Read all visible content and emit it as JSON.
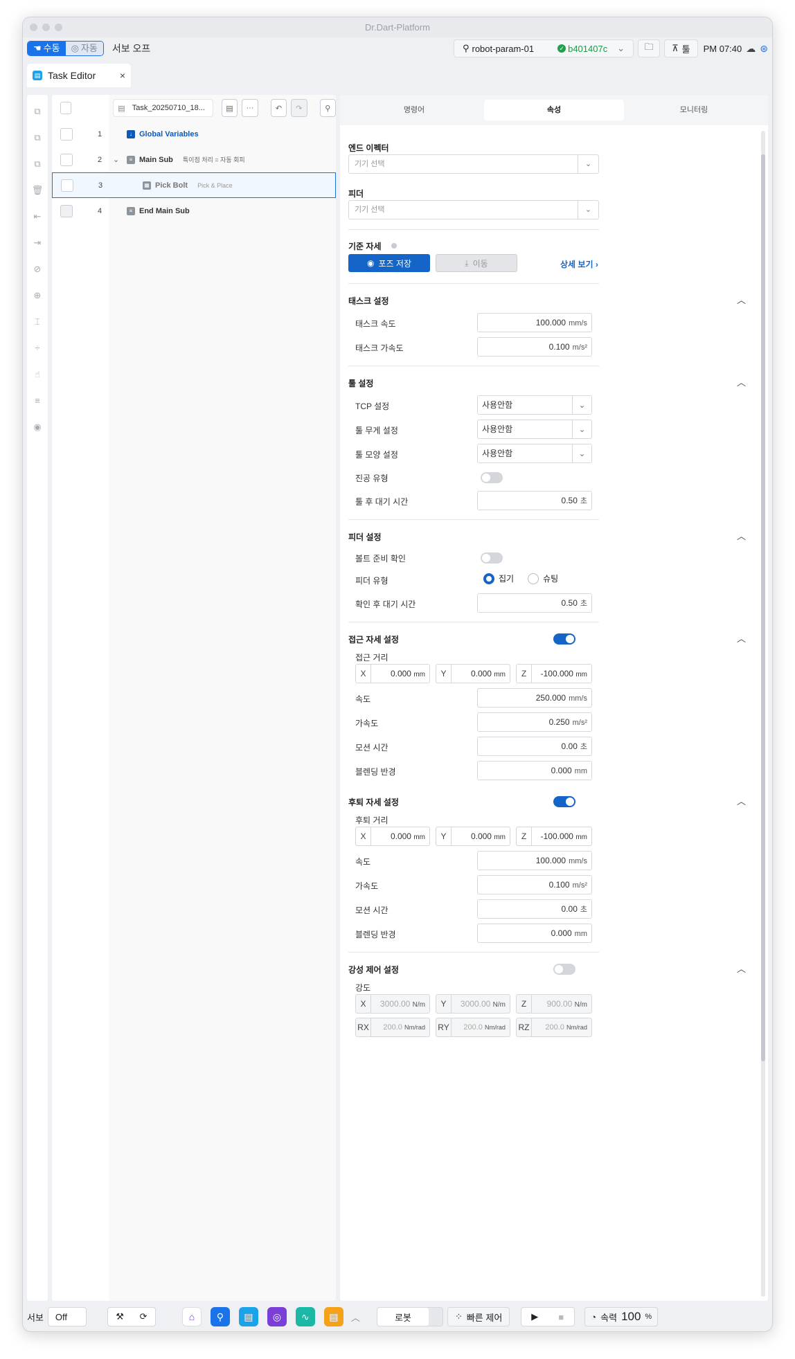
{
  "window": {
    "title": "Dr.Dart-Platform"
  },
  "toolbar": {
    "manual": "수동",
    "auto": "자동",
    "servo_off": "서보 오프",
    "robot_name": "robot-param-01",
    "version": "b401407c",
    "tool": "툴",
    "time": "PM 07:40"
  },
  "tab": {
    "label": "Task Editor",
    "close": "×"
  },
  "tree": {
    "file_name": "Task_20250710_18...",
    "more": "···",
    "rows": [
      {
        "num": "1",
        "label": "Global Variables",
        "sub": ""
      },
      {
        "num": "2",
        "label": "Main Sub",
        "sub": "특이점 처리 = 자동 회피"
      },
      {
        "num": "3",
        "label": "Pick Bolt",
        "sub": "Pick & Place"
      },
      {
        "num": "4",
        "label": "End Main Sub",
        "sub": ""
      }
    ]
  },
  "rtabs": [
    "명령어",
    "속성",
    "모니터링"
  ],
  "props": {
    "end_effector": {
      "title": "엔드 이펙터",
      "placeholder": "기기 선택"
    },
    "feeder": {
      "title": "피더",
      "placeholder": "기기 선택"
    },
    "ref_pose": {
      "title": "기준 자세",
      "save": "포즈 저장",
      "move": "이동",
      "detail": "상세 보기"
    },
    "task": {
      "title": "태스크 설정",
      "speed_label": "태스크 속도",
      "speed": "100.000",
      "speed_unit": "mm/s",
      "acc_label": "태스크 가속도",
      "acc": "0.100",
      "acc_unit": "m/s²"
    },
    "tool": {
      "title": "툴 설정",
      "tcp_label": "TCP 설정",
      "tcp": "사용안함",
      "weight_label": "툴 무게 설정",
      "weight": "사용안함",
      "shape_label": "툴 모양 설정",
      "shape": "사용안함",
      "vacuum_label": "진공 유형",
      "wait_label": "툴 후 대기 시간",
      "wait": "0.50",
      "wait_unit": "초"
    },
    "feeder_set": {
      "title": "피더 설정",
      "ready_label": "볼트 준비 확인",
      "type_label": "피더 유형",
      "opt1": "집기",
      "opt2": "슈팅",
      "wait_label": "확인 후 대기 시간",
      "wait": "0.50",
      "wait_unit": "초"
    },
    "approach": {
      "title": "접근 자세 설정",
      "dist_label": "접근 거리",
      "x": "0.000",
      "y": "0.000",
      "z": "-100.000",
      "unit": "mm",
      "speed_label": "속도",
      "speed": "250.000",
      "speed_unit": "mm/s",
      "acc_label": "가속도",
      "acc": "0.250",
      "acc_unit": "m/s²",
      "time_label": "모션 시간",
      "time": "0.00",
      "time_unit": "초",
      "blend_label": "블렌딩 반경",
      "blend": "0.000",
      "blend_unit": "mm"
    },
    "retreat": {
      "title": "후퇴 자세 설정",
      "dist_label": "후퇴 거리",
      "x": "0.000",
      "y": "0.000",
      "z": "-100.000",
      "unit": "mm",
      "speed_label": "속도",
      "speed": "100.000",
      "speed_unit": "mm/s",
      "acc_label": "가속도",
      "acc": "0.100",
      "acc_unit": "m/s²",
      "time_label": "모션 시간",
      "time": "0.00",
      "time_unit": "초",
      "blend_label": "블렌딩 반경",
      "blend": "0.000",
      "blend_unit": "mm"
    },
    "compliance": {
      "title": "강성 제어 설정",
      "stiff_label": "강도",
      "x": "3000.00",
      "y": "3000.00",
      "z": "900.00",
      "unit": "N/m",
      "rx": "200.0",
      "ry": "200.0",
      "rz": "200.0",
      "runit": "Nm/rad"
    }
  },
  "labels": {
    "X": "X",
    "Y": "Y",
    "Z": "Z",
    "RX": "RX",
    "RY": "RY",
    "RZ": "RZ"
  },
  "bottom": {
    "servo": "서보",
    "servo_state": "Off",
    "robot": "로봇",
    "quick": "빠른 제어",
    "speed_label": "속력",
    "speed": "100",
    "speed_unit": "%"
  },
  "colors": {
    "accent": "#1565c8",
    "brand_blue": "#1a73e8",
    "success": "#21a04c"
  }
}
